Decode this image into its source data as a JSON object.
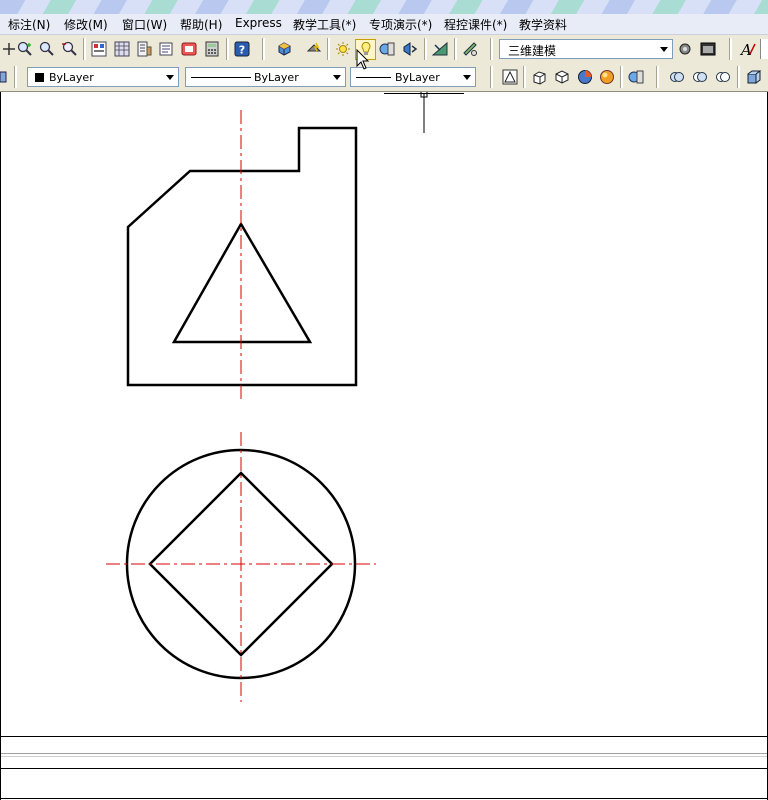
{
  "menu": {
    "items": [
      "标注(N)",
      "修改(M)",
      "窗口(W)",
      "帮助(H)",
      "Express",
      "教学工具(*)",
      "专项演示(*)",
      "程控课件(*)",
      "教学资料"
    ]
  },
  "toolbar1": {
    "workspace_value": "三维建模"
  },
  "toolbar2": {
    "color_value": "ByLayer",
    "linetype_value": "ByLayer",
    "lineweight_value": "ByLayer"
  },
  "colors": {
    "centerline": "#d40000",
    "geometry": "#000000",
    "toolbar_bg": "#ece9d8",
    "menubar_bg": "#e8ecf6"
  }
}
